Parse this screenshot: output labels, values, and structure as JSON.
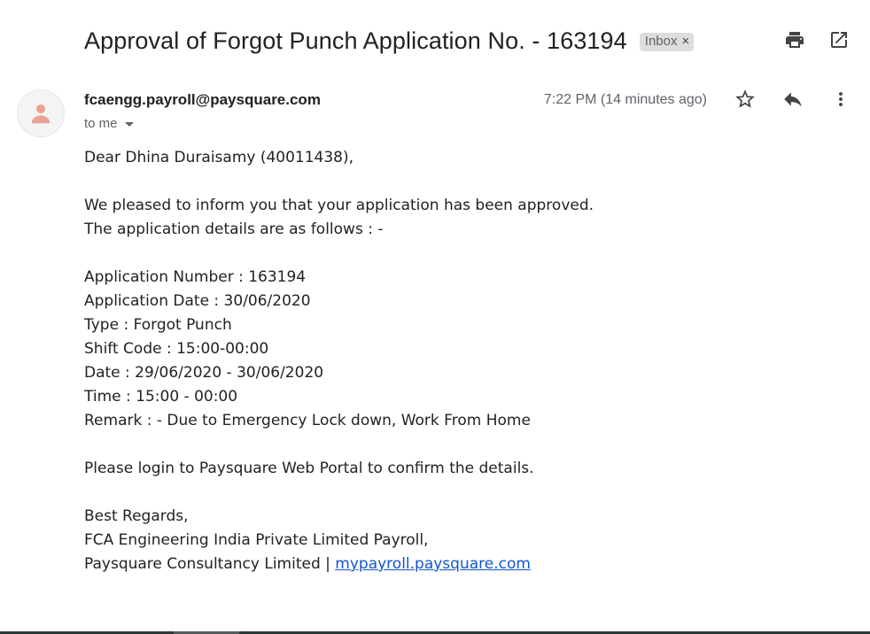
{
  "email": {
    "subject": "Approval of Forgot Punch Application No. - 163194",
    "label": "Inbox",
    "label_remove": "×",
    "sender": "fcaengg.payroll@paysquare.com",
    "recipient": "to me",
    "time": "7:22 PM (14 minutes ago)"
  },
  "icons": {
    "print": "print-icon",
    "open_new_window": "open-in-new-window-icon",
    "avatar": "person-icon",
    "star": "star-icon",
    "reply": "reply-icon",
    "more": "more-vert-icon"
  },
  "body": {
    "greeting": "Dear Dhina Duraisamy (40011438),",
    "line1": "We pleased to inform you that your application has been approved.",
    "line2": "The application details are as follows : -",
    "app_number": "Application Number : 163194",
    "app_date": "Application Date : 30/06/2020",
    "type": "Type : Forgot Punch",
    "shift": "Shift Code : 15:00-00:00",
    "date": "Date : 29/06/2020 - 30/06/2020",
    "time": "Time : 15:00 - 00:00",
    "remark": "Remark : - Due to Emergency Lock down, Work From Home",
    "login": "Please login to Paysquare Web Portal to confirm the details.",
    "regards": "Best Regards,",
    "company": "FCA Engineering India Private Limited Payroll,",
    "consultancy": "Paysquare Consultancy Limited | ",
    "link_text": "mypayroll.paysquare.com"
  },
  "colors": {
    "link": "#1155cc",
    "avatar_icon": "#e8a394",
    "chip_bg": "#dddddd"
  }
}
